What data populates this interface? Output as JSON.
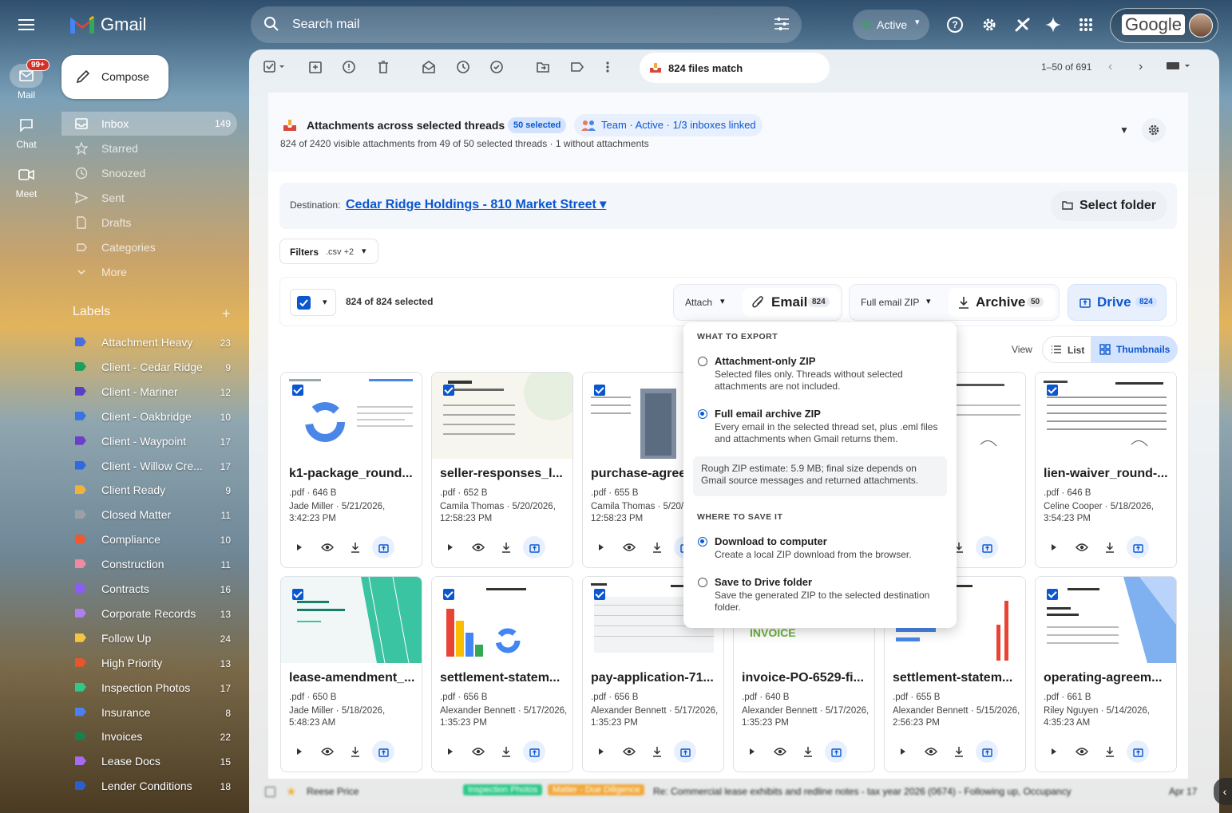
{
  "app": {
    "name": "Gmail",
    "google_label": "Google"
  },
  "rail": {
    "mail_label": "Mail",
    "mail_badge": "99+",
    "chat_label": "Chat",
    "meet_label": "Meet"
  },
  "header": {
    "search_placeholder": "Search mail",
    "status": "Active"
  },
  "compose_label": "Compose",
  "nav": [
    {
      "label": "Inbox",
      "count": "149"
    },
    {
      "label": "Starred",
      "count": ""
    },
    {
      "label": "Snoozed",
      "count": ""
    },
    {
      "label": "Sent",
      "count": ""
    },
    {
      "label": "Drafts",
      "count": ""
    },
    {
      "label": "Categories",
      "count": ""
    },
    {
      "label": "More",
      "count": ""
    }
  ],
  "labels_heading": "Labels",
  "labels": [
    {
      "label": "Attachment Heavy",
      "count": "23",
      "color": "#4a6ee0"
    },
    {
      "label": "Client - Cedar Ridge",
      "count": "9",
      "color": "#1e9e5a"
    },
    {
      "label": "Client - Mariner",
      "count": "12",
      "color": "#5b3fc4"
    },
    {
      "label": "Client - Oakbridge",
      "count": "10",
      "color": "#3a74e0"
    },
    {
      "label": "Client - Waypoint",
      "count": "17",
      "color": "#6a3fc9"
    },
    {
      "label": "Client - Willow Cre...",
      "count": "17",
      "color": "#2f6ae0"
    },
    {
      "label": "Client Ready",
      "count": "9",
      "color": "#f2b13c"
    },
    {
      "label": "Closed Matter",
      "count": "11",
      "color": "#9aa0a6"
    },
    {
      "label": "Compliance",
      "count": "10",
      "color": "#f0582d"
    },
    {
      "label": "Construction",
      "count": "11",
      "color": "#f08aa0"
    },
    {
      "label": "Contracts",
      "count": "16",
      "color": "#8b5cf6"
    },
    {
      "label": "Corporate Records",
      "count": "13",
      "color": "#b07ef0"
    },
    {
      "label": "Follow Up",
      "count": "24",
      "color": "#f5c542"
    },
    {
      "label": "High Priority",
      "count": "13",
      "color": "#e8542e"
    },
    {
      "label": "Inspection Photos",
      "count": "17",
      "color": "#2fc98a"
    },
    {
      "label": "Insurance",
      "count": "8",
      "color": "#4c7ff0"
    },
    {
      "label": "Invoices",
      "count": "22",
      "color": "#1a7f4a"
    },
    {
      "label": "Lease Docs",
      "count": "15",
      "color": "#a56cf0"
    },
    {
      "label": "Lender Conditions",
      "count": "18",
      "color": "#2a5fcf"
    }
  ],
  "toolbar": {
    "match_text": "824 files match",
    "pager": "1–50 of 691"
  },
  "panel": {
    "title": "Attachments across selected threads",
    "selected_chip": "50 selected",
    "team_chip": "Team · Active · 1/3 inboxes linked",
    "subtitle": "824 of 2420 visible attachments from 49 of 50 selected threads · 1 without attachments",
    "destination_label": "Destination:",
    "destination_value": "Cedar Ridge Holdings - 810 Market Street",
    "select_folder": "Select folder",
    "filters_label": "Filters",
    "filters_value": ".csv +2",
    "selected_count": "824 of 824 selected",
    "attach_label": "Attach",
    "email_label": "Email",
    "email_count": "824",
    "zip_mode": "Full email ZIP",
    "archive_label": "Archive",
    "archive_count": "50",
    "drive_label": "Drive",
    "drive_count": "824",
    "view_label": "View",
    "view_list": "List",
    "view_thumbnails": "Thumbnails"
  },
  "popup": {
    "what_heading": "WHAT TO EXPORT",
    "opt1_title": "Attachment-only ZIP",
    "opt1_desc": "Selected files only. Threads without selected attachments are not included.",
    "opt2_title": "Full email archive ZIP",
    "opt2_desc": "Every email in the selected thread set, plus .eml files and attachments when Gmail returns them.",
    "note": "Rough ZIP estimate: 5.9 MB; final size depends on Gmail source messages and returned attachments.",
    "where_heading": "WHERE TO SAVE IT",
    "opt3_title": "Download to computer",
    "opt3_desc": "Create a local ZIP download from the browser.",
    "opt4_title": "Save to Drive folder",
    "opt4_desc": "Save the generated ZIP to the selected destination folder."
  },
  "cards": [
    {
      "name": "k1-package_round...",
      "meta1": ".pdf · 646 B",
      "meta2": "Jade Miller · 5/21/2026, 3:42:23 PM"
    },
    {
      "name": "seller-responses_l...",
      "meta1": ".pdf · 652 B",
      "meta2": "Camila Thomas · 5/20/2026, 12:58:23 PM"
    },
    {
      "name": "purchase-agree",
      "meta1": ".pdf · 655 B",
      "meta2": "Camila Thomas · 5/20/ 12:58:23 PM"
    },
    {
      "name": "",
      "meta1": "",
      "meta2": ""
    },
    {
      "name": "nstructi...",
      "meta1": "",
      "meta2": "ett · 23 PM"
    },
    {
      "name": "lien-waiver_round-...",
      "meta1": ".pdf · 646 B",
      "meta2": "Celine Cooper · 5/18/2026, 3:54:23 PM"
    },
    {
      "name": "lease-amendment_...",
      "meta1": ".pdf · 650 B",
      "meta2": "Jade Miller · 5/18/2026, 5:48:23 AM"
    },
    {
      "name": "settlement-statem...",
      "meta1": ".pdf · 656 B",
      "meta2": "Alexander Bennett · 5/17/2026, 1:35:23 PM"
    },
    {
      "name": "pay-application-71...",
      "meta1": ".pdf · 656 B",
      "meta2": "Alexander Bennett · 5/17/2026, 1:35:23 PM"
    },
    {
      "name": "invoice-PO-6529-fi...",
      "meta1": ".pdf · 640 B",
      "meta2": "Alexander Bennett · 5/17/2026, 1:35:23 PM"
    },
    {
      "name": "settlement-statem...",
      "meta1": ".pdf · 655 B",
      "meta2": "Alexander Bennett · 5/15/2026, 2:56:23 PM"
    },
    {
      "name": "operating-agreem...",
      "meta1": ".pdf · 661 B",
      "meta2": "Riley Nguyen · 5/14/2026, 4:35:23 AM"
    }
  ],
  "invoice_thumb_text": "INVOICE",
  "peek": {
    "sender": "Reese Price",
    "chip1": "Inspection Photos",
    "chip2": "Matter - Due Diligence",
    "subject": "Re: Commercial lease exhibits and redline notes - tax year 2026 (0674) - Following up, Occupancy",
    "date": "Apr 17"
  }
}
